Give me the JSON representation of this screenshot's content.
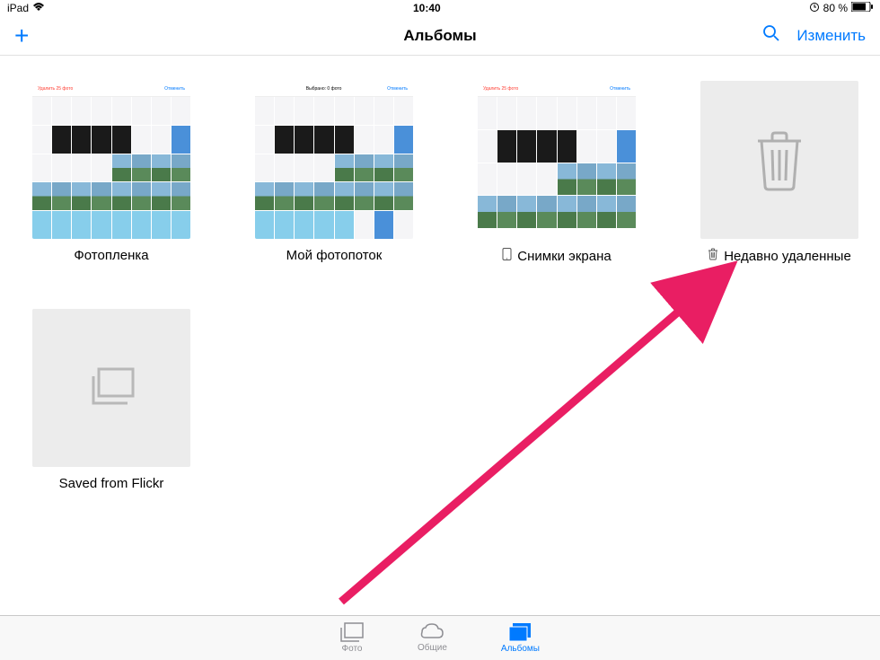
{
  "statusBar": {
    "device": "iPad",
    "time": "10:40",
    "battery": "80 %"
  },
  "navBar": {
    "title": "Альбомы",
    "editLabel": "Изменить"
  },
  "albums": [
    {
      "label": "Фотопленка",
      "type": "grid"
    },
    {
      "label": "Мой фотопоток",
      "type": "grid"
    },
    {
      "label": "Снимки экрана",
      "type": "grid",
      "icon": "device"
    },
    {
      "label": "Недавно удаленные",
      "type": "trash",
      "icon": "trash"
    },
    {
      "label": "Saved from Flickr",
      "type": "empty"
    }
  ],
  "tabs": [
    {
      "label": "Фото",
      "active": false
    },
    {
      "label": "Общие",
      "active": false
    },
    {
      "label": "Альбомы",
      "active": true
    }
  ]
}
